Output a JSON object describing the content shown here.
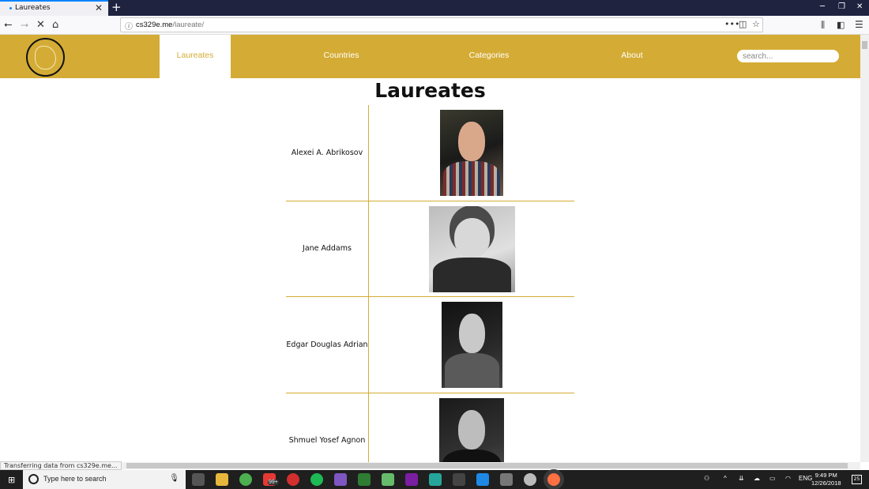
{
  "browser": {
    "tab_title": "Laureates",
    "tab_close": "✕",
    "new_tab": "+",
    "url_host": "cs329e.me",
    "url_path": "/laureate/",
    "status_text": "Transferring data from cs329e.me..."
  },
  "site": {
    "nav": [
      {
        "label": "Laureates",
        "active": true
      },
      {
        "label": "Countries",
        "active": false
      },
      {
        "label": "Categories",
        "active": false
      },
      {
        "label": "About",
        "active": false
      }
    ],
    "search_placeholder": "search...",
    "accent_color": "#d4ac35"
  },
  "page": {
    "title": "Laureates",
    "laureates": [
      {
        "name": "Alexei A. Abrikosov"
      },
      {
        "name": "Jane Addams"
      },
      {
        "name": "Edgar Douglas Adrian"
      },
      {
        "name": "Shmuel Yosef Agnon"
      }
    ]
  },
  "taskbar": {
    "search_text": "Type here to search",
    "badge": "99+",
    "language": "ENG",
    "time": "9:49 PM",
    "date": "12/26/2018",
    "notifications": "25"
  }
}
